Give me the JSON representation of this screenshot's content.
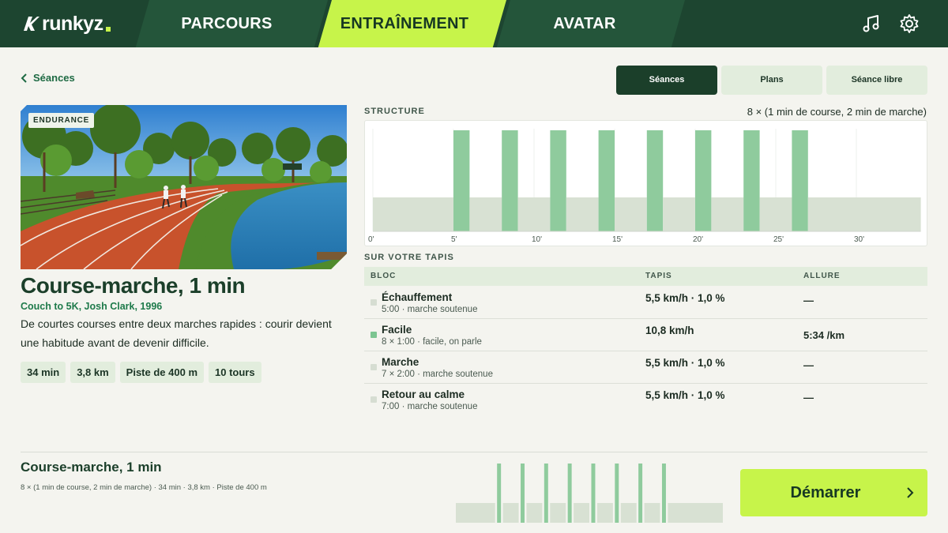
{
  "app": {
    "logo": "runkyz"
  },
  "nav": {
    "tabs": [
      {
        "label": "PARCOURS",
        "active": false
      },
      {
        "label": "ENTRAÎNEMENT",
        "active": true
      },
      {
        "label": "AVATAR",
        "active": false
      }
    ],
    "icons": [
      "music-icon",
      "gear-icon"
    ]
  },
  "back": {
    "label": "Séances"
  },
  "segments": [
    {
      "label": "Séances",
      "active": true
    },
    {
      "label": "Plans",
      "active": false
    },
    {
      "label": "Séance libre",
      "active": false
    }
  ],
  "workout": {
    "badge": "ENDURANCE",
    "title": "Course-marche, 1 min",
    "source": "Couch to 5K, Josh Clark, 1996",
    "description": "De courtes courses entre deux marches rapides : courir devient une habitude avant de devenir difficile.",
    "chips": [
      "34 min",
      "3,8 km",
      "Piste de 400 m",
      "10 tours"
    ]
  },
  "structure": {
    "label": "STRUCTURE",
    "summary": "8 × (1 min de course, 2 min de marche)",
    "ticks": [
      "0'",
      "5'",
      "10'",
      "15'",
      "20'",
      "25'",
      "30'"
    ]
  },
  "chart_data": {
    "type": "bar",
    "x_unit": "min",
    "xlim": [
      0,
      34
    ],
    "ticks": [
      0,
      5,
      10,
      15,
      20,
      25,
      30
    ],
    "segments": [
      {
        "start": 0,
        "end": 5,
        "kind": "walk"
      },
      {
        "start": 5,
        "end": 6,
        "kind": "run"
      },
      {
        "start": 6,
        "end": 8,
        "kind": "walk"
      },
      {
        "start": 8,
        "end": 9,
        "kind": "run"
      },
      {
        "start": 9,
        "end": 11,
        "kind": "walk"
      },
      {
        "start": 11,
        "end": 12,
        "kind": "run"
      },
      {
        "start": 12,
        "end": 14,
        "kind": "walk"
      },
      {
        "start": 14,
        "end": 15,
        "kind": "run"
      },
      {
        "start": 15,
        "end": 17,
        "kind": "walk"
      },
      {
        "start": 17,
        "end": 18,
        "kind": "run"
      },
      {
        "start": 18,
        "end": 20,
        "kind": "walk"
      },
      {
        "start": 20,
        "end": 21,
        "kind": "run"
      },
      {
        "start": 21,
        "end": 23,
        "kind": "walk"
      },
      {
        "start": 23,
        "end": 24,
        "kind": "run"
      },
      {
        "start": 24,
        "end": 26,
        "kind": "walk"
      },
      {
        "start": 26,
        "end": 27,
        "kind": "run"
      },
      {
        "start": 27,
        "end": 34,
        "kind": "walk"
      }
    ],
    "colors": {
      "run": "#8fcb9d",
      "walk": "#d8e1d3"
    }
  },
  "treadmill": {
    "label": "SUR VOTRE TAPIS",
    "headers": [
      "BLOC",
      "TAPIS",
      "ALLURE"
    ],
    "rows": [
      {
        "name": "Échauffement",
        "sub": "5:00 · marche soutenue",
        "tapis": "5,5 km/h · 1,0 %",
        "allure": "—",
        "color": "#d6ddd2"
      },
      {
        "name": "Facile",
        "sub": "8 × 1:00 · facile, on parle",
        "tapis": "10,8 km/h",
        "allure": "5:34 /km",
        "color": "#7cc591"
      },
      {
        "name": "Marche",
        "sub": "7 × 2:00 · marche soutenue",
        "tapis": "5,5 km/h · 1,0 %",
        "allure": "—",
        "color": "#d6ddd2"
      },
      {
        "name": "Retour au calme",
        "sub": "7:00 · marche soutenue",
        "tapis": "5,5 km/h · 1,0 %",
        "allure": "—",
        "color": "#d6ddd2"
      }
    ]
  },
  "footer": {
    "title": "Course-marche, 1 min",
    "meta": "8 × (1 min de course, 2 min de marche) · 34 min · 3,8 km · Piste de 400 m",
    "start_label": "Démarrer"
  }
}
